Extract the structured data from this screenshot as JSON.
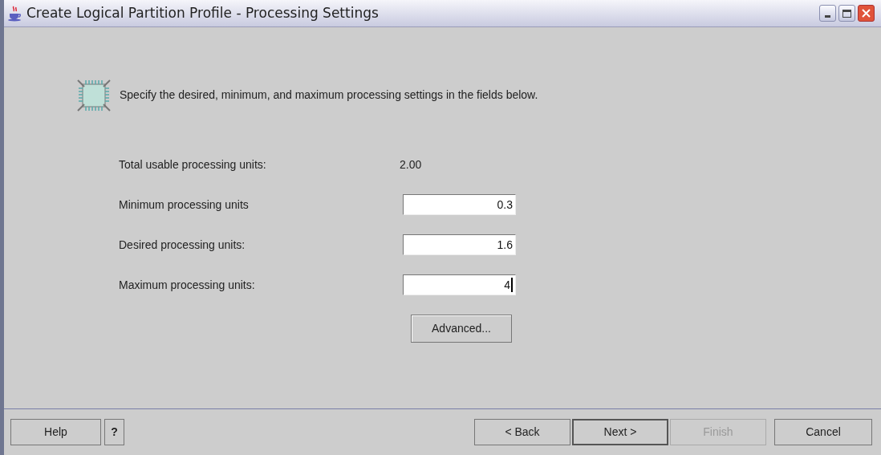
{
  "window": {
    "title": "Create Logical Partition Profile - Processing Settings"
  },
  "instruction": "Specify the desired, minimum, and maximum processing settings in the fields below.",
  "total": {
    "label": "Total usable processing units:",
    "value": "2.00"
  },
  "fields": [
    {
      "label": "Minimum processing units",
      "value": "0.3",
      "focused": false
    },
    {
      "label": "Desired processing units:",
      "value": "1.6",
      "focused": false
    },
    {
      "label": "Maximum processing units:",
      "value": "4",
      "focused": true
    }
  ],
  "advanced_button": "Advanced...",
  "footer_left": [
    {
      "label": "Help"
    },
    {
      "label": "?"
    }
  ],
  "footer_right": [
    {
      "label": "< Back",
      "disabled": false,
      "default": false
    },
    {
      "label": "Next >",
      "disabled": false,
      "default": true
    },
    {
      "label": "Finish",
      "disabled": true,
      "default": false
    }
  ],
  "cancel": "Cancel"
}
